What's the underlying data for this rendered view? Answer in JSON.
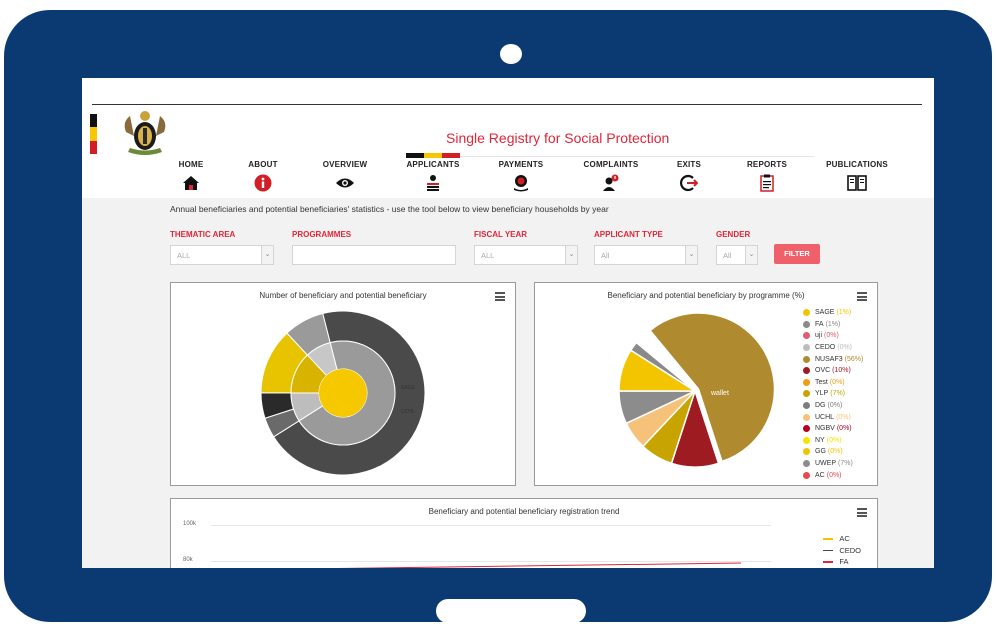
{
  "header": {
    "title": "Single Registry for Social Protection",
    "flag_colors": [
      "#111111",
      "#f5c800",
      "#d21f26"
    ]
  },
  "nav": [
    {
      "label": "HOME",
      "icon": "home-icon"
    },
    {
      "label": "ABOUT",
      "icon": "info-icon"
    },
    {
      "label": "OVERVIEW",
      "icon": "eye-icon"
    },
    {
      "label": "APPLICANTS",
      "icon": "applicants-icon",
      "active": true
    },
    {
      "label": "PAYMENTS",
      "icon": "payments-icon"
    },
    {
      "label": "COMPLAINTS",
      "icon": "complaints-icon"
    },
    {
      "label": "EXITS",
      "icon": "exit-icon"
    },
    {
      "label": "REPORTS",
      "icon": "reports-icon"
    },
    {
      "label": "PUBLICATIONS",
      "icon": "publications-icon"
    }
  ],
  "intro": "Annual beneficiaries and potential beneficiaries' statistics - use the tool below to view beneficiary households by year",
  "filters": {
    "thematic_area": {
      "label": "THEMATIC AREA",
      "value": "ALL"
    },
    "programmes": {
      "label": "PROGRAMMES",
      "value": ""
    },
    "fiscal_year": {
      "label": "FISCAL YEAR",
      "value": "ALL"
    },
    "applicant_type": {
      "label": "APPLICANT TYPE",
      "value": "All"
    },
    "gender": {
      "label": "GENDER",
      "value": "All"
    },
    "filter_button": "FILTER"
  },
  "sunburst_panel": {
    "title": "Number of beneficiary and potential beneficiary",
    "labels": [
      "NUSAF 3",
      "UWEP",
      "SAGE",
      "UCHL"
    ]
  },
  "pie_panel": {
    "title": "Beneficiary and potential beneficiary by programme (%)",
    "slice_label": "wallet",
    "legend": [
      {
        "name": "SAGE",
        "pct": "(1%)",
        "color": "#f2c500"
      },
      {
        "name": "FA",
        "pct": "(1%)",
        "color": "#8a8a8a"
      },
      {
        "name": "uji",
        "pct": "(0%)",
        "color": "#e05d6f"
      },
      {
        "name": "CEDO",
        "pct": "(0%)",
        "color": "#bdbdbd"
      },
      {
        "name": "NUSAF3",
        "pct": "(56%)",
        "color": "#b08a2e"
      },
      {
        "name": "OVC",
        "pct": "(10%)",
        "color": "#9e1b22"
      },
      {
        "name": "Test",
        "pct": "(0%)",
        "color": "#f39c12"
      },
      {
        "name": "YLP",
        "pct": "(7%)",
        "color": "#c8a400"
      },
      {
        "name": "DG",
        "pct": "(0%)",
        "color": "#7d7d7d"
      },
      {
        "name": "UCHL",
        "pct": "(0%)",
        "color": "#f6c27a"
      },
      {
        "name": "NGBV",
        "pct": "(0%)",
        "color": "#b3001b"
      },
      {
        "name": "NY",
        "pct": "(0%)",
        "color": "#f5e400"
      },
      {
        "name": "GG",
        "pct": "(0%)",
        "color": "#f0c400"
      },
      {
        "name": "UWEP",
        "pct": "(7%)",
        "color": "#8c8c8c"
      },
      {
        "name": "AC",
        "pct": "(0%)",
        "color": "#e8494f"
      }
    ]
  },
  "chart_data": [
    {
      "type": "pie",
      "title": "Beneficiary and potential beneficiary by programme (%)",
      "categories": [
        "NUSAF3",
        "OVC",
        "YLP",
        "UCHL",
        "UWEP",
        "SAGE",
        "FA",
        "wallet"
      ],
      "values": [
        56,
        10,
        7,
        6,
        7,
        9,
        2,
        3
      ]
    },
    {
      "type": "line",
      "title": "Beneficiary and potential beneficiary registration trend",
      "y_ticks": [
        "100k",
        "80k"
      ],
      "series": [
        {
          "name": "AC",
          "color": "#f2c500"
        },
        {
          "name": "CEDO",
          "color": "#444444"
        },
        {
          "name": "FA",
          "color": "#e0263a"
        }
      ]
    }
  ],
  "trend_panel": {
    "title": "Beneficiary and potential beneficiary registration trend",
    "y_ticks": [
      "100k",
      "80k"
    ],
    "legend": [
      {
        "name": "AC",
        "color": "#f2c500"
      },
      {
        "name": "CEDO",
        "color": "#444444"
      },
      {
        "name": "FA",
        "color": "#e0263a"
      }
    ]
  }
}
